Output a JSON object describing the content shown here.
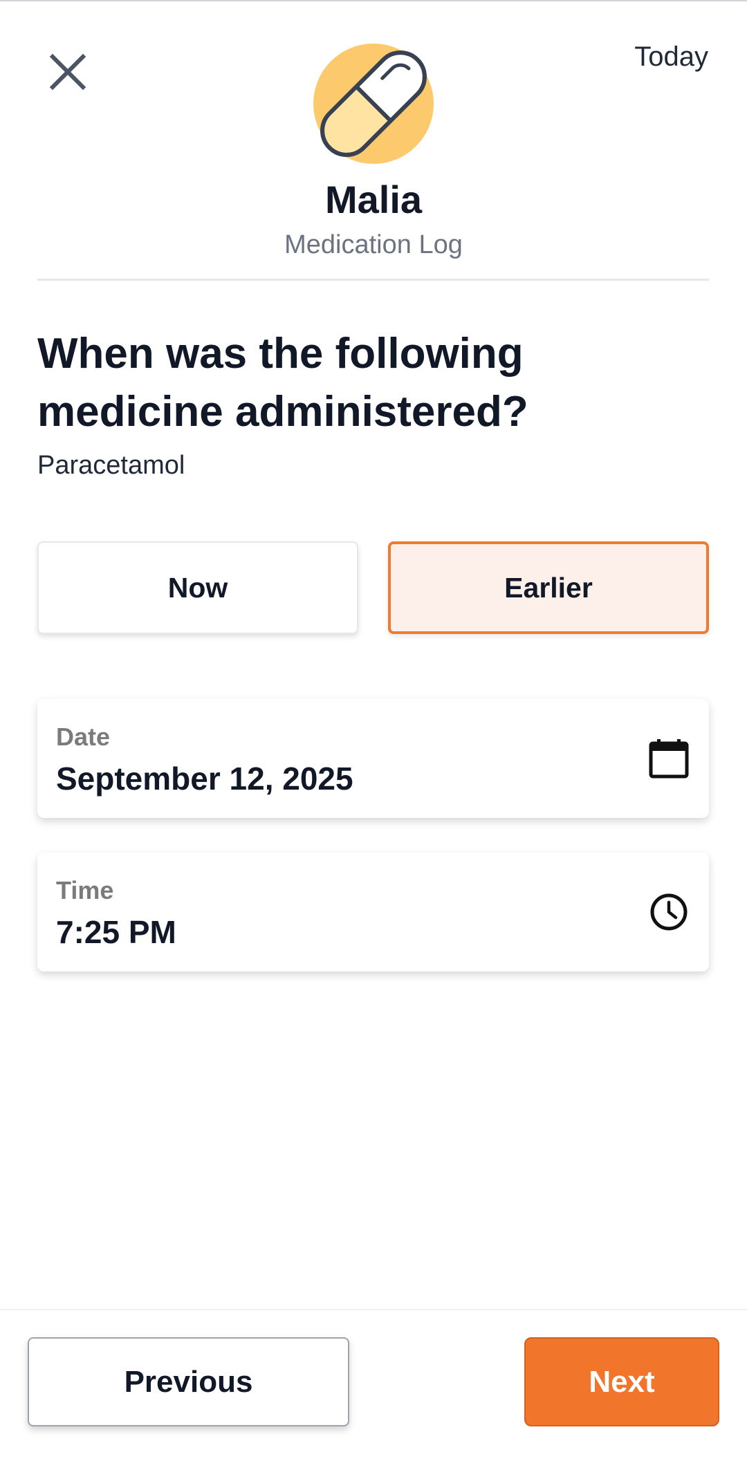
{
  "header": {
    "close_icon": "close-icon",
    "today_label": "Today",
    "icon": "pill-icon",
    "icon_colors": {
      "circle": "#fcca6c",
      "capsule_light": "#ffe3a3",
      "outline": "#374151"
    },
    "patient_name": "Malia",
    "subtitle": "Medication Log"
  },
  "question": {
    "text": "When was the following medicine administered?",
    "medicine": "Paracetamol"
  },
  "choices": {
    "now_label": "Now",
    "earlier_label": "Earlier",
    "selected": "Earlier"
  },
  "fields": {
    "date": {
      "label": "Date",
      "value": "September 12, 2025",
      "icon": "calendar-icon"
    },
    "time": {
      "label": "Time",
      "value": "7:25 PM",
      "icon": "clock-icon"
    }
  },
  "footer": {
    "previous_label": "Previous",
    "next_label": "Next"
  },
  "colors": {
    "accent": "#f1752a",
    "selected_bg": "#fdf0ea",
    "selected_border": "#ef7c2e"
  }
}
